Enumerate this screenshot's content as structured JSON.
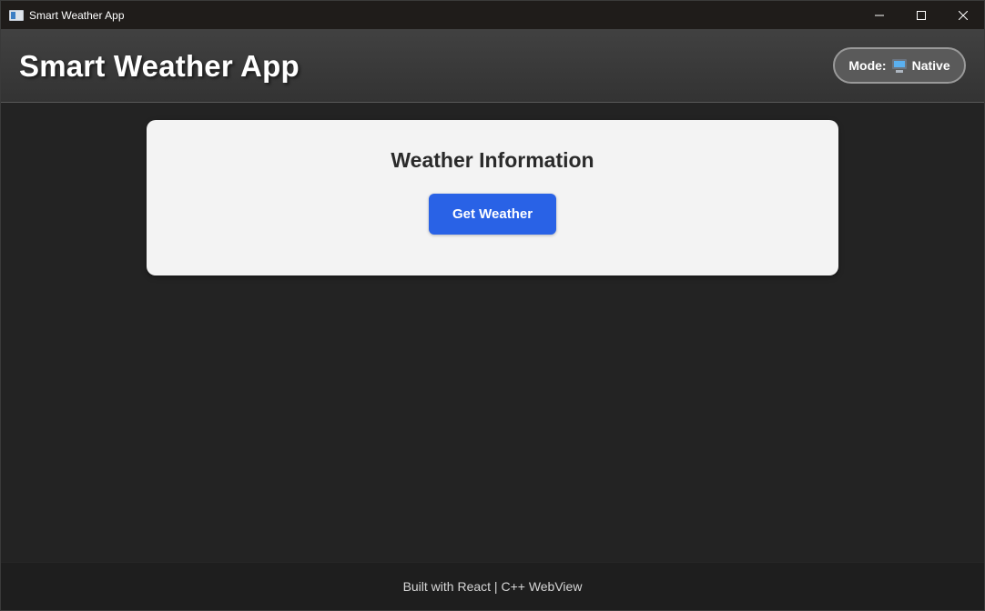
{
  "window": {
    "title": "Smart Weather App"
  },
  "header": {
    "title": "Smart Weather App",
    "mode_label": "Mode:",
    "mode_icon": "desktop-monitor-icon",
    "mode_value": "Native"
  },
  "card": {
    "title": "Weather Information",
    "button_label": "Get Weather"
  },
  "footer": {
    "text": "Built with React | C++ WebView"
  },
  "colors": {
    "background": "#232323",
    "header": "#3a3a3a",
    "card": "#f3f3f3",
    "button": "#2962e6"
  }
}
